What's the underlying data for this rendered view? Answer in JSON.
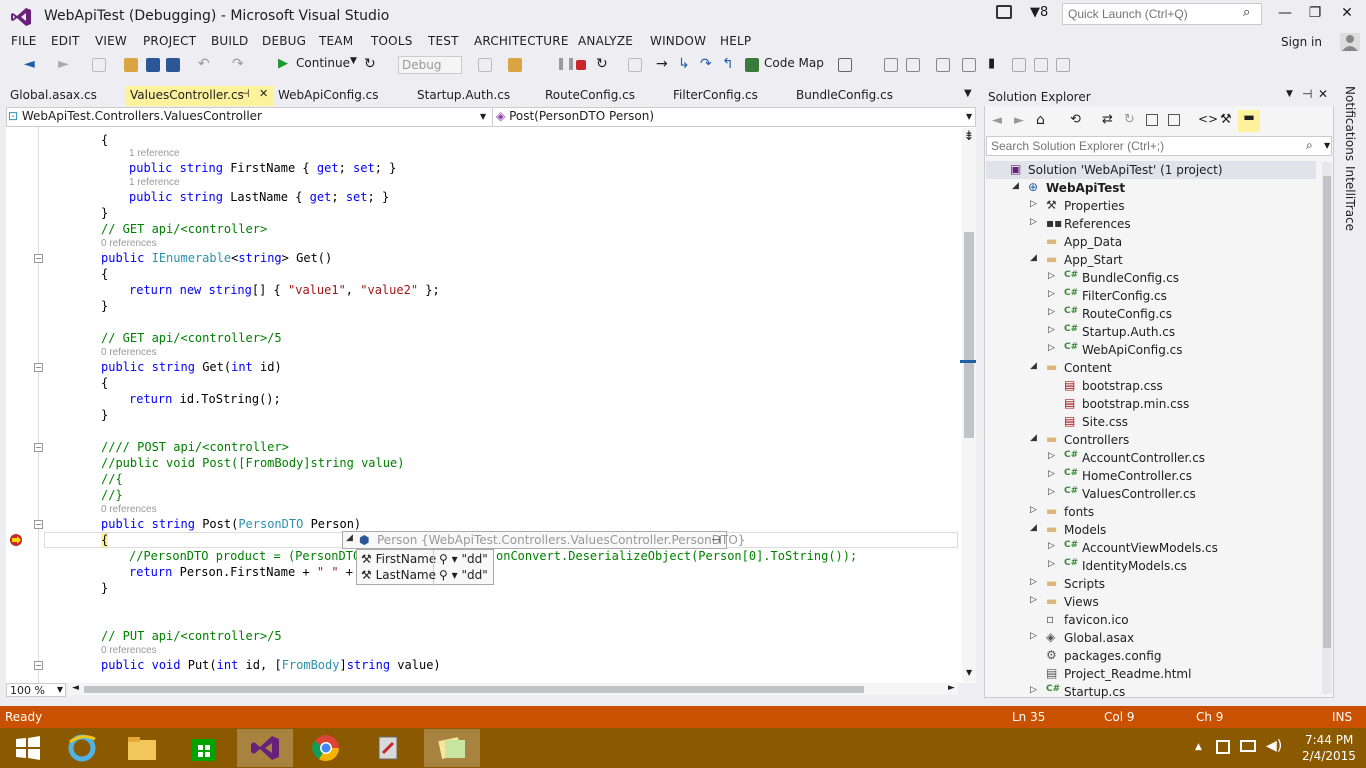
{
  "window": {
    "title": "WebApiTest (Debugging) - Microsoft Visual Studio",
    "notification_count": "8",
    "quick_launch_placeholder": "Quick Launch (Ctrl+Q)",
    "sign_in": "Sign in"
  },
  "menu": [
    "FILE",
    "EDIT",
    "VIEW",
    "PROJECT",
    "BUILD",
    "DEBUG",
    "TEAM",
    "TOOLS",
    "TEST",
    "ARCHITECTURE",
    "ANALYZE",
    "WINDOW",
    "HELP"
  ],
  "toolbar": {
    "continue_label": "Continue",
    "config_value": "Debug",
    "code_map_label": "Code Map"
  },
  "doc_tabs": [
    "Global.asax.cs",
    "ValuesController.cs",
    "WebApiConfig.cs",
    "Startup.Auth.cs",
    "RouteConfig.cs",
    "FilterConfig.cs",
    "BundleConfig.cs"
  ],
  "nav": {
    "type_dropdown": "WebApiTest.Controllers.ValuesController",
    "member_dropdown": "Post(PersonDTO Person)"
  },
  "code": {
    "refs": {
      "one": "1 reference",
      "zero": "0 references"
    },
    "l1": "{",
    "l2a": "public",
    "l2b": "string",
    "l2c": "FirstName { ",
    "l2d": "get",
    "l2e": "; ",
    "l2f": "set",
    "l2g": "; }",
    "l3c": "LastName { ",
    "l4": "}",
    "c1": "// GET api/<controller>",
    "l5b": "IEnumerable",
    "l5c": "<",
    "l5d": "string",
    "l5e": "> Get()",
    "l6a": "return",
    "l6b": "new",
    "l6c": "string",
    "l6d": "[] { ",
    "l6e": "\"value1\"",
    "l6f": ", ",
    "l6g": "\"value2\"",
    "l6h": " };",
    "c2": "// GET api/<controller>/5",
    "l7c": "Get(",
    "l7d": "int",
    "l7e": " id)",
    "l8b": "id.ToString();",
    "c3": "//// POST api/<controller>",
    "c4": "//public void Post([FromBody]string value)",
    "c5": "//{",
    "c6": "//}",
    "l9c": "Post(",
    "l9d": "PersonDTO",
    "l9e": " Person)",
    "c7a": "//PersonDTO product = (PersonDTO",
    "c7b": "onConvert.DeserializeObject(Person[0].ToString());",
    "l10b": "Person.FirstName + ",
    "l10c": "\" \"",
    "l10d": " + P",
    "c8": "// PUT api/<controller>/5",
    "l11b": "void",
    "l11c": "Put(",
    "l11d": "int",
    "l11e": " id, [",
    "l11f": "FromBody",
    "l11g": "]",
    "l11h": "string",
    "l11i": " value)"
  },
  "datatip": {
    "header_name": "Person",
    "header_value": "{WebApiTest.Controllers.ValuesController.PersonDTO}",
    "rows": [
      {
        "name": "FirstName",
        "value": "\"dd\""
      },
      {
        "name": "LastName",
        "value": "\"dd\""
      }
    ]
  },
  "zoom_value": "100 %",
  "solution_explorer": {
    "title": "Solution Explorer",
    "search_placeholder": "Search Solution Explorer (Ctrl+;)",
    "items": [
      {
        "label": "Solution 'WebApiTest' (1 project)",
        "icon": "solution-icon",
        "indent": 0,
        "expander": ""
      },
      {
        "label": "WebApiTest",
        "icon": "project-icon",
        "indent": 1,
        "expander": "open"
      },
      {
        "label": "Properties",
        "icon": "wrench-icon",
        "indent": 2,
        "expander": "closed"
      },
      {
        "label": "References",
        "icon": "references-icon",
        "indent": 2,
        "expander": "closed"
      },
      {
        "label": "App_Data",
        "icon": "folder-icon",
        "indent": 2,
        "expander": ""
      },
      {
        "label": "App_Start",
        "icon": "folder-open-icon",
        "indent": 2,
        "expander": "open"
      },
      {
        "label": "BundleConfig.cs",
        "icon": "csharp-file-icon",
        "indent": 3,
        "expander": "closed"
      },
      {
        "label": "FilterConfig.cs",
        "icon": "csharp-file-icon",
        "indent": 3,
        "expander": "closed"
      },
      {
        "label": "RouteConfig.cs",
        "icon": "csharp-file-icon",
        "indent": 3,
        "expander": "closed"
      },
      {
        "label": "Startup.Auth.cs",
        "icon": "csharp-file-icon",
        "indent": 3,
        "expander": "closed"
      },
      {
        "label": "WebApiConfig.cs",
        "icon": "csharp-file-icon",
        "indent": 3,
        "expander": "closed"
      },
      {
        "label": "Content",
        "icon": "folder-open-icon",
        "indent": 2,
        "expander": "open"
      },
      {
        "label": "bootstrap.css",
        "icon": "css-file-icon",
        "indent": 3,
        "expander": ""
      },
      {
        "label": "bootstrap.min.css",
        "icon": "css-file-icon",
        "indent": 3,
        "expander": ""
      },
      {
        "label": "Site.css",
        "icon": "css-file-icon",
        "indent": 3,
        "expander": ""
      },
      {
        "label": "Controllers",
        "icon": "folder-open-icon",
        "indent": 2,
        "expander": "open"
      },
      {
        "label": "AccountController.cs",
        "icon": "csharp-file-icon",
        "indent": 3,
        "expander": "closed"
      },
      {
        "label": "HomeController.cs",
        "icon": "csharp-file-icon",
        "indent": 3,
        "expander": "closed"
      },
      {
        "label": "ValuesController.cs",
        "icon": "csharp-file-icon",
        "indent": 3,
        "expander": "closed"
      },
      {
        "label": "fonts",
        "icon": "folder-icon",
        "indent": 2,
        "expander": "closed"
      },
      {
        "label": "Models",
        "icon": "folder-open-icon",
        "indent": 2,
        "expander": "open"
      },
      {
        "label": "AccountViewModels.cs",
        "icon": "csharp-file-icon",
        "indent": 3,
        "expander": "closed"
      },
      {
        "label": "IdentityModels.cs",
        "icon": "csharp-file-icon",
        "indent": 3,
        "expander": "closed"
      },
      {
        "label": "Scripts",
        "icon": "folder-icon",
        "indent": 2,
        "expander": "closed"
      },
      {
        "label": "Views",
        "icon": "folder-icon",
        "indent": 2,
        "expander": "closed"
      },
      {
        "label": "favicon.ico",
        "icon": "ico-file-icon",
        "indent": 2,
        "expander": ""
      },
      {
        "label": "Global.asax",
        "icon": "asax-file-icon",
        "indent": 2,
        "expander": "closed"
      },
      {
        "label": "packages.config",
        "icon": "config-file-icon",
        "indent": 2,
        "expander": ""
      },
      {
        "label": "Project_Readme.html",
        "icon": "html-file-icon",
        "indent": 2,
        "expander": ""
      },
      {
        "label": "Startup.cs",
        "icon": "csharp-file-icon",
        "indent": 2,
        "expander": "closed"
      }
    ]
  },
  "side_tabs": [
    "Notifications",
    "IntelliTrace"
  ],
  "status": {
    "state": "Ready",
    "line": "Ln 35",
    "col": "Col 9",
    "ch": "Ch 9",
    "mode": "INS"
  },
  "taskbar": {
    "time": "7:44 PM",
    "date": "2/4/2015"
  },
  "colors": {
    "status_bar": "#ca5100",
    "taskbar": "#8b5a00",
    "active_tab": "#fff29d",
    "vs_purple": "#68217a"
  }
}
